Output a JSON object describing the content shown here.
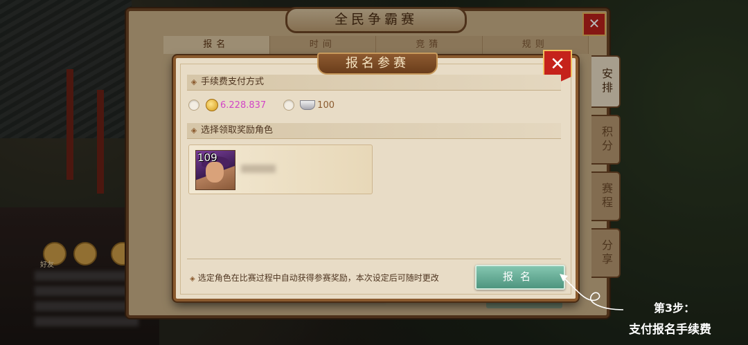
{
  "background": {
    "social_label": "好友"
  },
  "back_panel": {
    "title": "全民争霸赛",
    "close_label": "✕",
    "tabs": [
      {
        "label": "报名"
      },
      {
        "label": "时间"
      },
      {
        "label": "竞猜"
      },
      {
        "label": "规则"
      }
    ],
    "side_tabs": [
      {
        "label": "安排"
      },
      {
        "label": "积分"
      },
      {
        "label": "赛程"
      },
      {
        "label": "分享"
      }
    ],
    "action_label": "报名"
  },
  "dialog": {
    "title": "报名参赛",
    "close_label": "✕",
    "payment_section": {
      "heading": "手续费支付方式",
      "options": [
        {
          "icon": "gold-coin-icon",
          "amount": "6.228.837",
          "color": "#d245c6"
        },
        {
          "icon": "silver-ingot-icon",
          "amount": "100",
          "color": "#8a5a2e"
        }
      ]
    },
    "role_section": {
      "heading": "选择领取奖励角色",
      "role": {
        "level": "109"
      }
    },
    "footer_note": "选定角色在比赛过程中自动获得参赛奖励，本次设定后可随时更改",
    "signup_label": "报名"
  },
  "annotation": {
    "step": "第3步：",
    "text": "支付报名手续费"
  },
  "colors": {
    "dialog_bg": "#e8dcc6",
    "frame": "#8a5a2e",
    "close_red": "#c5221b",
    "signup_green": "#4e957f"
  }
}
